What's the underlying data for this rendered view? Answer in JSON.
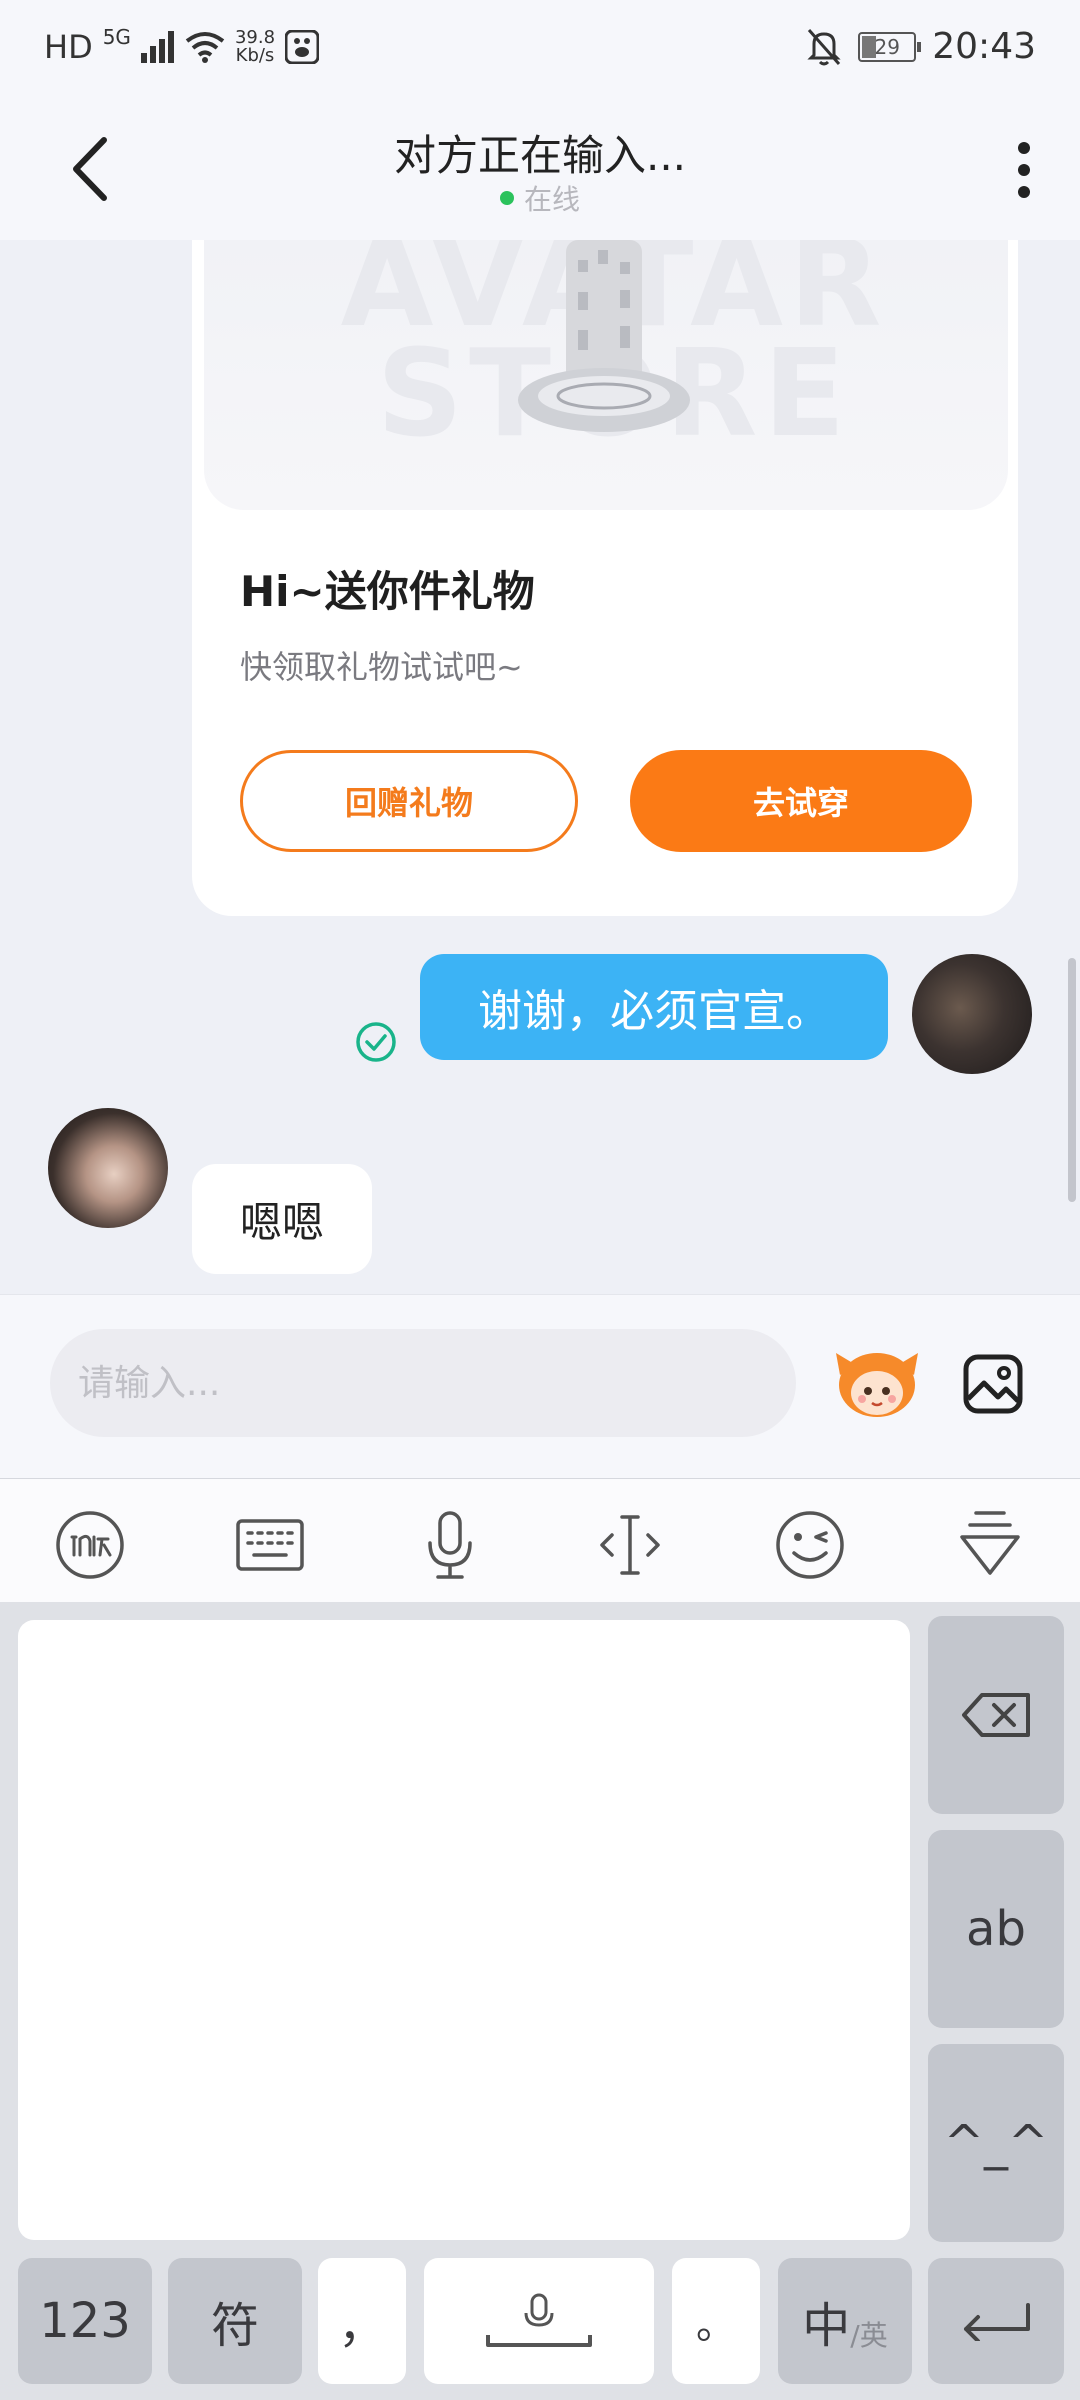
{
  "status_bar": {
    "carrier": "HD",
    "network": "5G",
    "speed_value": "39.8",
    "speed_unit": "Kb/s",
    "battery": "29",
    "time": "20:43"
  },
  "header": {
    "title": "对方正在输入...",
    "status": "在线"
  },
  "gift_card": {
    "image_text": "AVATAR STORE",
    "title": "Hi~送你件礼物",
    "subtitle": "快领取礼物试试吧~",
    "return_gift_label": "回赠礼物",
    "try_on_label": "去试穿"
  },
  "messages": [
    {
      "direction": "out",
      "text": "谢谢，必须官宣。"
    },
    {
      "direction": "in",
      "text": "嗯嗯"
    }
  ],
  "input": {
    "placeholder": "请输入..."
  },
  "keyboard": {
    "keys": {
      "num": "123",
      "symbols": "符",
      "comma": "，",
      "period": "。",
      "lang_main": "中",
      "lang_alt": "/英",
      "ab": "ab",
      "face": "^_^"
    }
  },
  "colors": {
    "accent_orange": "#fb7a15",
    "bubble_blue": "#3cb3f5",
    "online_green": "#2bc25c"
  }
}
